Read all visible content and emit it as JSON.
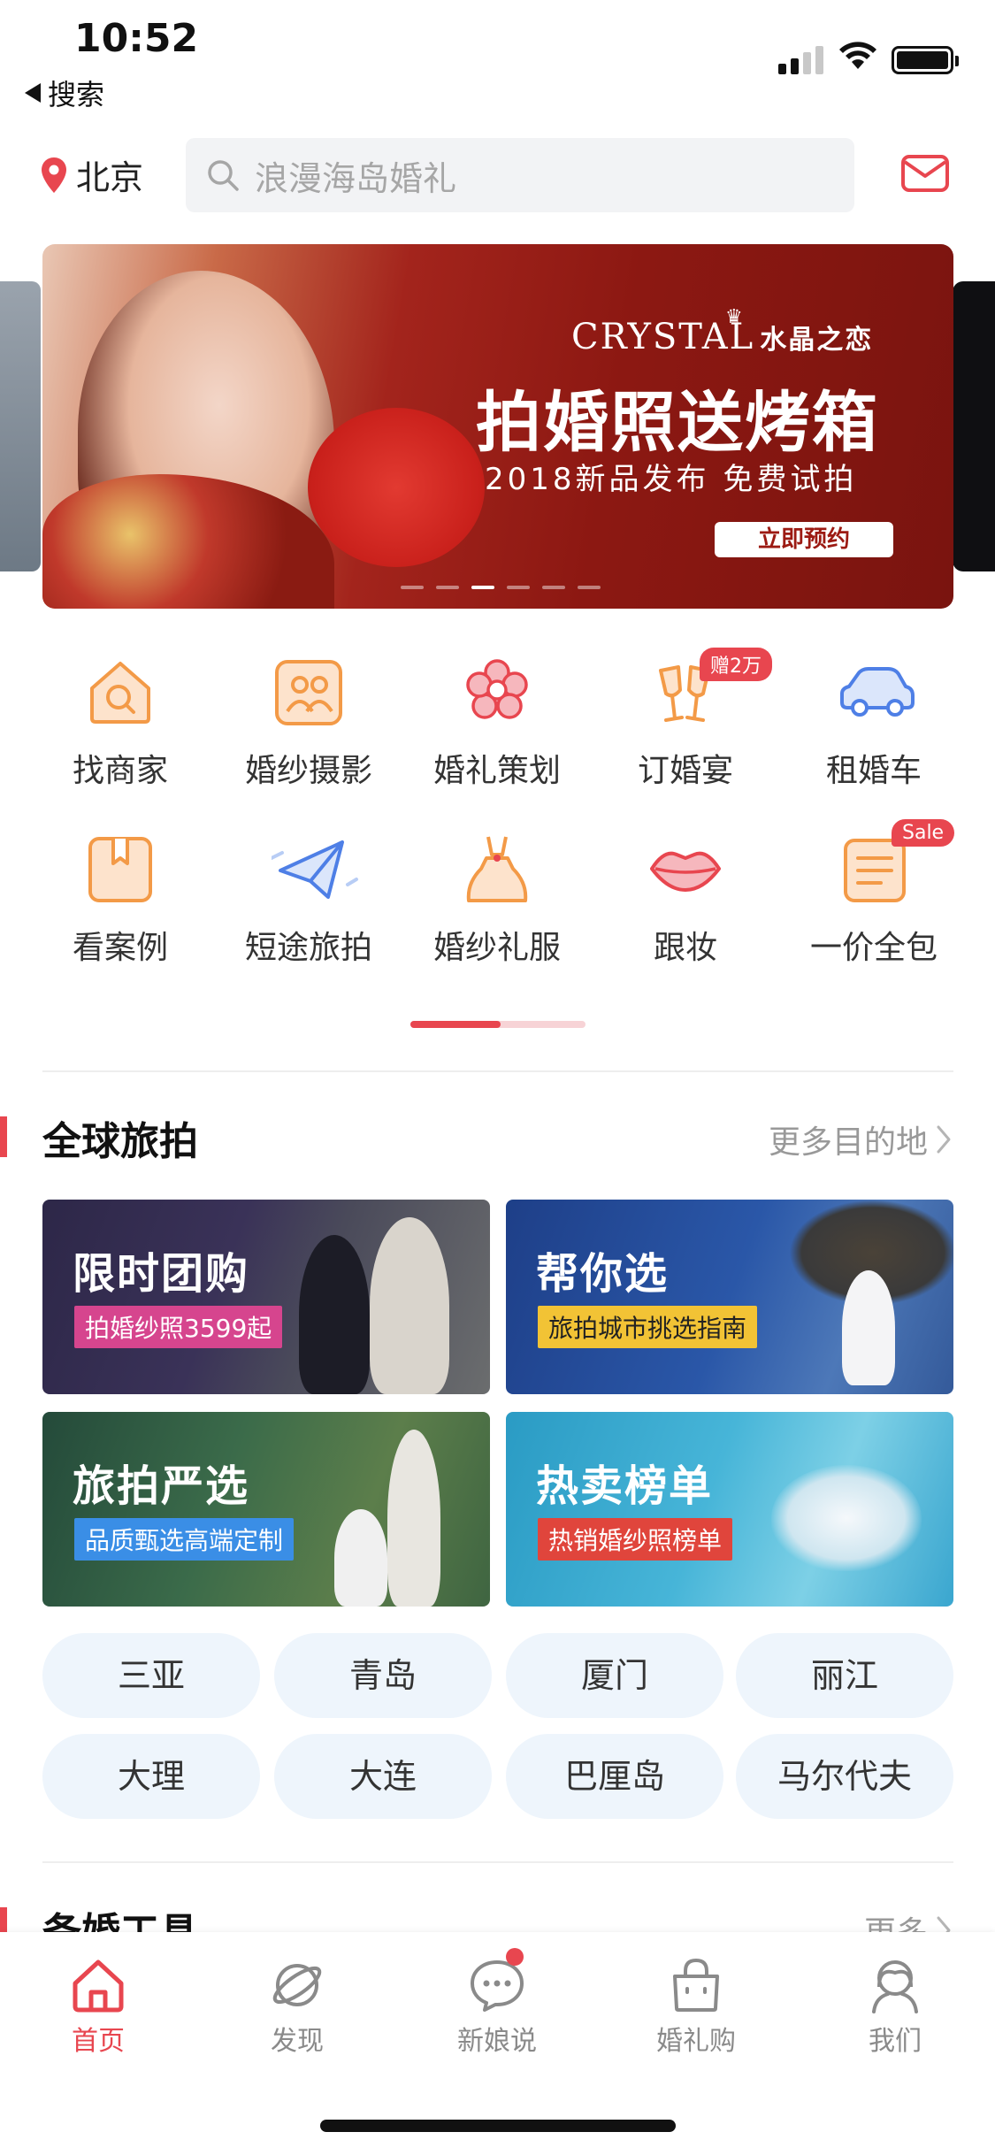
{
  "status_bar": {
    "time": "10:52",
    "back_app": "搜索"
  },
  "header": {
    "city": "北京",
    "search_placeholder": "浪漫海岛婚礼"
  },
  "banner": {
    "brand": "CRYSTAL",
    "brand_cn": "水晶之恋",
    "headline": "拍婚照送烤箱",
    "subline": "2018新品发布  免费试拍",
    "cta": "立即预约",
    "page_count": 6,
    "active_index": 2
  },
  "categories": [
    {
      "label": "找商家",
      "icon": "store-search-icon"
    },
    {
      "label": "婚纱摄影",
      "icon": "photo-people-icon"
    },
    {
      "label": "婚礼策划",
      "icon": "flower-icon"
    },
    {
      "label": "订婚宴",
      "icon": "cheers-glasses-icon",
      "badge": "赠2万"
    },
    {
      "label": "租婚车",
      "icon": "car-icon"
    },
    {
      "label": "看案例",
      "icon": "bookmark-box-icon"
    },
    {
      "label": "短途旅拍",
      "icon": "paper-plane-icon"
    },
    {
      "label": "婚纱礼服",
      "icon": "dress-icon"
    },
    {
      "label": "跟妆",
      "icon": "lips-icon"
    },
    {
      "label": "一价全包",
      "icon": "package-list-icon",
      "badge": "Sale"
    }
  ],
  "global_travel": {
    "title": "全球旅拍",
    "more": "更多目的地",
    "cards": [
      {
        "title": "限时团购",
        "tag": "拍婚纱照3599起",
        "tag_color": "#d6458e"
      },
      {
        "title": "帮你选",
        "tag": "旅拍城市挑选指南",
        "tag_color": "#f2c335"
      },
      {
        "title": "旅拍严选",
        "tag": "品质甄选高端定制",
        "tag_color": "#3a8ee6"
      },
      {
        "title": "热卖榜单",
        "tag": "热销婚纱照榜单",
        "tag_color": "#e0453c"
      }
    ],
    "cities": [
      "三亚",
      "青岛",
      "厦门",
      "丽江",
      "大理",
      "大连",
      "巴厘岛",
      "马尔代夫"
    ]
  },
  "prep_tools": {
    "title": "备婚工具",
    "more": "更多"
  },
  "tabbar": [
    {
      "label": "首页",
      "icon": "home-icon",
      "active": true
    },
    {
      "label": "发现",
      "icon": "planet-icon"
    },
    {
      "label": "新娘说",
      "icon": "chat-bubble-icon",
      "dot": true
    },
    {
      "label": "婚礼购",
      "icon": "shopping-bag-icon"
    },
    {
      "label": "我们",
      "icon": "couple-icon"
    }
  ],
  "colors": {
    "accent": "#e8464f",
    "orange": "#f39a47",
    "blue": "#4e7fe6",
    "chip_bg": "#eef5fc"
  }
}
